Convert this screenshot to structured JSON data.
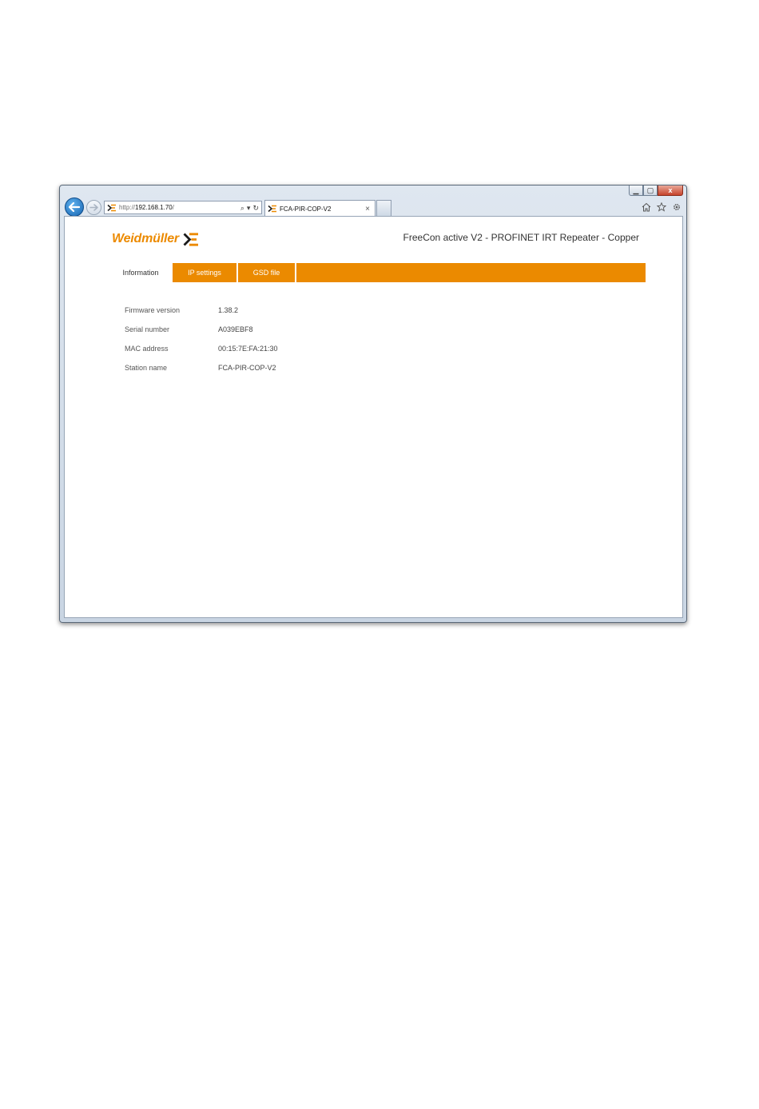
{
  "browser": {
    "url_prefix": "http://",
    "url_host": "192.168.1.70",
    "url_suffix": "/",
    "tab_title": "FCA-PIR-COP-V2",
    "tab_close": "×",
    "search_glyph": "⌕",
    "dropdown_glyph": "▾",
    "refresh_glyph": "↻",
    "minimize_glyph": "▁",
    "maximize_glyph": "▢",
    "close_glyph": "x"
  },
  "page": {
    "brand_name": "Weidmüller",
    "product_title": "FreeCon active V2 - PROFINET IRT Repeater - Copper",
    "tabs": [
      {
        "label": "Information",
        "active": true
      },
      {
        "label": "IP settings",
        "active": false
      },
      {
        "label": "GSD file",
        "active": false
      }
    ],
    "info": [
      {
        "label": "Firmware version",
        "value": "1.38.2"
      },
      {
        "label": "Serial number",
        "value": "A039EBF8"
      },
      {
        "label": "MAC address",
        "value": "00:15:7E:FA:21:30"
      },
      {
        "label": "Station name",
        "value": "FCA-PIR-COP-V2"
      }
    ]
  },
  "colors": {
    "accent": "#eb8a00",
    "back_button": "#1a6fc0"
  },
  "icons": [
    "back-arrow-icon",
    "forward-arrow-icon",
    "weidmuller-favicon-icon",
    "search-icon",
    "refresh-icon",
    "home-icon",
    "star-icon",
    "gear-icon"
  ]
}
